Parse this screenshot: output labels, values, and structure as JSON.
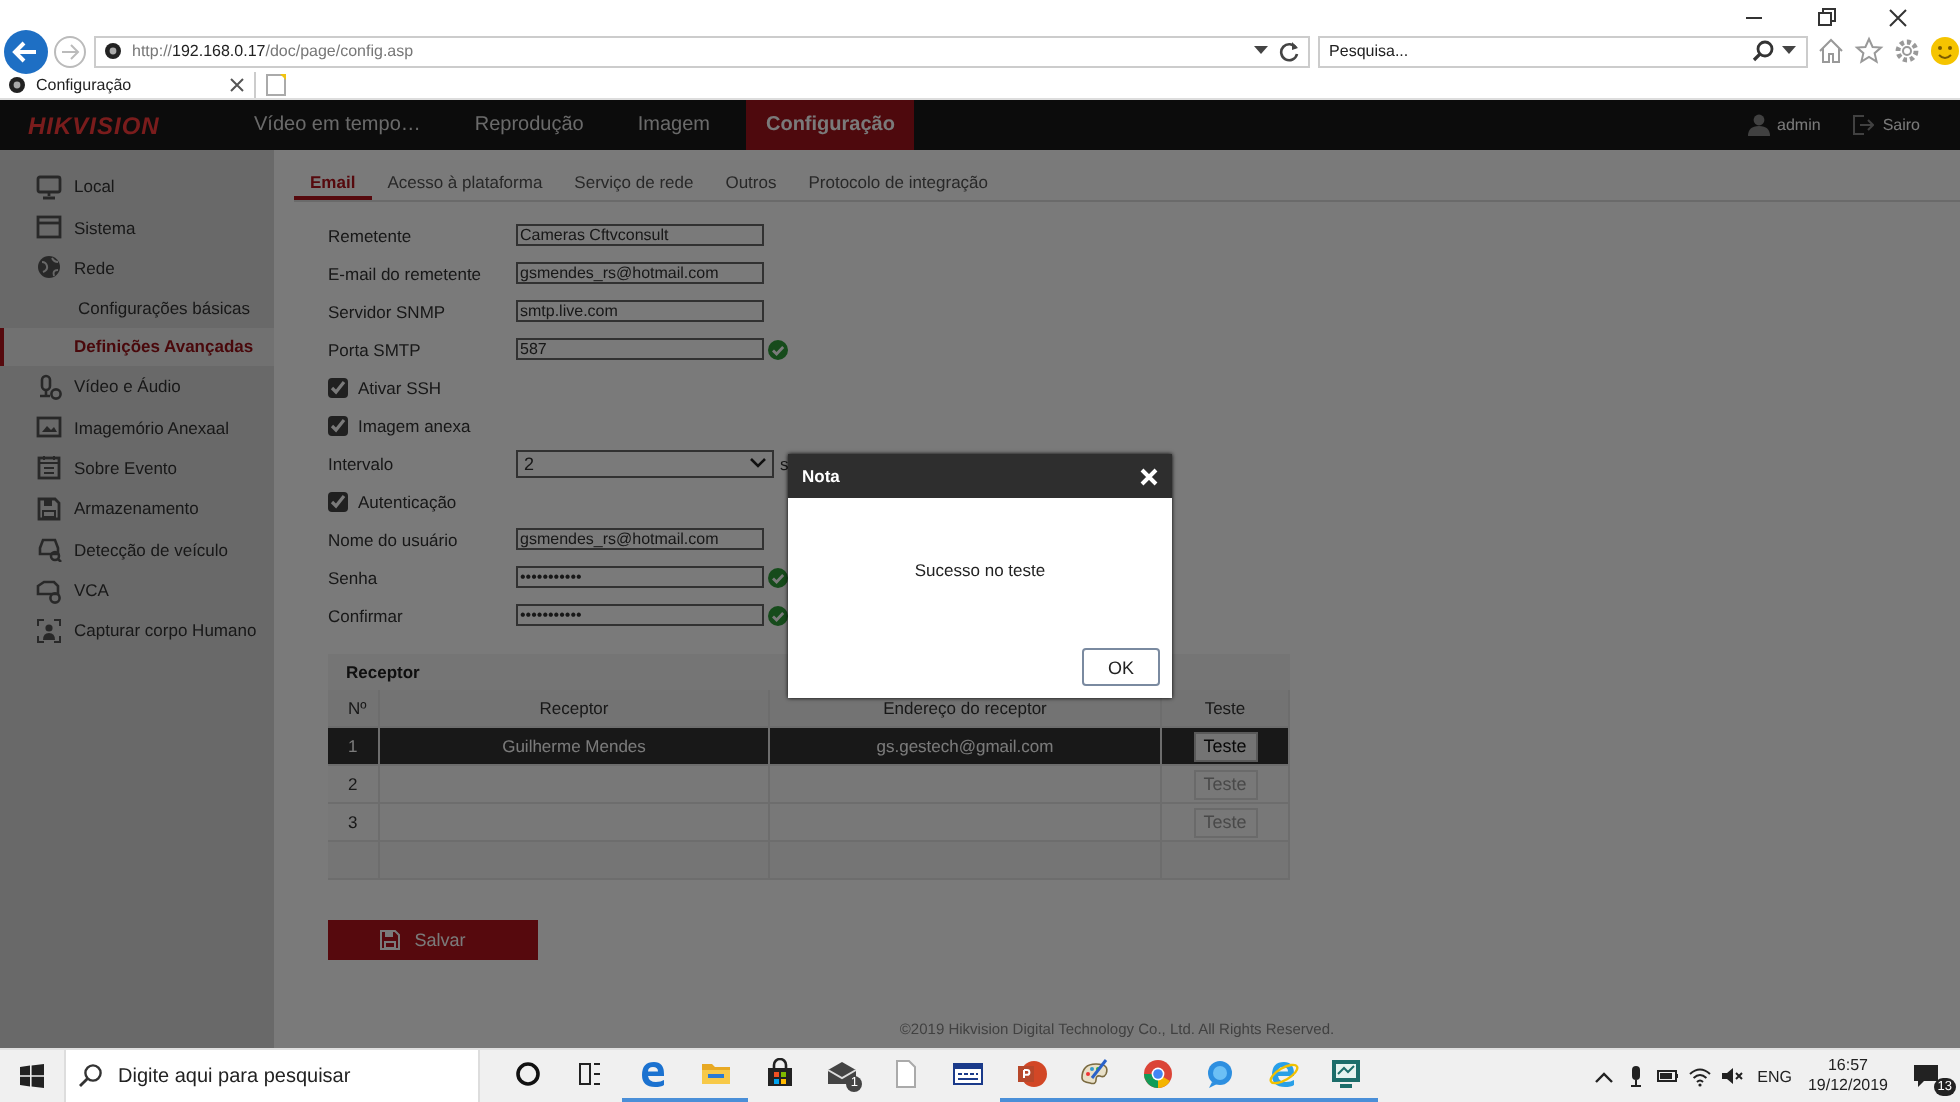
{
  "browser": {
    "url": "http://**192.168.0.17**/doc/page/config.asp",
    "search_placeholder": "Pesquisa...",
    "tab": {
      "title": "Configuração"
    }
  },
  "app": {
    "logo": "HIKVISION",
    "user": "admin",
    "logout": "Sairo",
    "nav": [
      {
        "label": "Vídeo em tempo…",
        "selected": false
      },
      {
        "label": "Reprodução",
        "selected": false
      },
      {
        "label": "Imagem",
        "selected": false
      },
      {
        "label": "Configuração",
        "selected": true
      }
    ]
  },
  "sidebar": {
    "items": [
      {
        "label": "Local",
        "selected": false
      },
      {
        "label": "Sistema",
        "selected": false
      },
      {
        "label": "Rede",
        "selected": false,
        "children": [
          {
            "label": "Configurações básicas",
            "selected": false
          },
          {
            "label": "Definições Avançadas",
            "selected": true
          }
        ]
      },
      {
        "label": "Vídeo e Áudio",
        "selected": false
      },
      {
        "label": "Imagemório Anexaal",
        "selected": false
      },
      {
        "label": "Sobre Evento",
        "selected": false
      },
      {
        "label": "Armazenamento",
        "selected": false
      },
      {
        "label": "Detecção de veículo",
        "selected": false
      },
      {
        "label": "VCA",
        "selected": false
      },
      {
        "label": "Capturar corpo Humano",
        "selected": false
      }
    ]
  },
  "tabs": [
    {
      "label": "Email",
      "selected": true
    },
    {
      "label": "Acesso à plataforma",
      "selected": false
    },
    {
      "label": "Serviço de rede",
      "selected": false
    },
    {
      "label": "Outros",
      "selected": false
    },
    {
      "label": "Protocolo de integração",
      "selected": false
    }
  ],
  "form": {
    "rows": [
      {
        "kind": "text",
        "label": "Remetente",
        "value": "Cameras Cftvconsult",
        "valid": false
      },
      {
        "kind": "text",
        "label": "E-mail do remetente",
        "value": "gsmendes_rs@hotmail.com",
        "valid": false
      },
      {
        "kind": "text",
        "label": "Servidor SNMP",
        "value": "smtp.live.com",
        "valid": false
      },
      {
        "kind": "text",
        "label": "Porta SMTP",
        "value": "587",
        "valid": true
      },
      {
        "kind": "check",
        "label": "Ativar SSH",
        "checked": true
      },
      {
        "kind": "check",
        "label": "Imagem anexa",
        "checked": true
      },
      {
        "kind": "select",
        "label": "Intervalo",
        "value": "2",
        "unit": "s"
      },
      {
        "kind": "check",
        "label": "Autenticação",
        "checked": true
      },
      {
        "kind": "text",
        "label": "Nome do usuário",
        "value": "gsmendes_rs@hotmail.com",
        "valid": false
      },
      {
        "kind": "text",
        "label": "Senha",
        "value": "•••••••••••",
        "valid": true
      },
      {
        "kind": "text",
        "label": "Confirmar",
        "value": "•••••••••••",
        "valid": true
      }
    ]
  },
  "table": {
    "title": "Receptor",
    "columns": [
      "Nº",
      "Receptor",
      "Endereço do receptor",
      "Teste"
    ],
    "rows": [
      {
        "number": "1",
        "name": "Guilherme Mendes",
        "address": "gs.gestech@gmail.com",
        "test": "Teste",
        "selected": true,
        "disabled": false
      },
      {
        "number": "2",
        "test": "Teste",
        "selected": false,
        "disabled": true
      },
      {
        "number": "3",
        "test": "Teste",
        "selected": false,
        "disabled": true
      }
    ]
  },
  "save_button": "Salvar",
  "footer": "©2019 Hikvision Digital Technology Co., Ltd. All Rights Reserved.",
  "modal": {
    "title": "Nota",
    "message": "Sucesso no teste",
    "button": "OK"
  },
  "taskbar": {
    "search_placeholder": "Digite aqui para pesquisar",
    "apps": [
      {
        "running": false
      },
      {
        "running": false
      },
      {
        "running": true
      },
      {
        "running": true
      },
      {
        "running": false
      },
      {
        "running": false,
        "badge": "1"
      },
      {
        "running": false
      },
      {
        "running": false
      },
      {
        "running": true
      },
      {
        "running": true
      },
      {
        "running": true
      },
      {
        "running": true
      },
      {
        "running": true
      },
      {
        "running": true
      }
    ],
    "language": "ENG",
    "time": "16:57",
    "date": "19/12/2019",
    "notifications": "13"
  }
}
